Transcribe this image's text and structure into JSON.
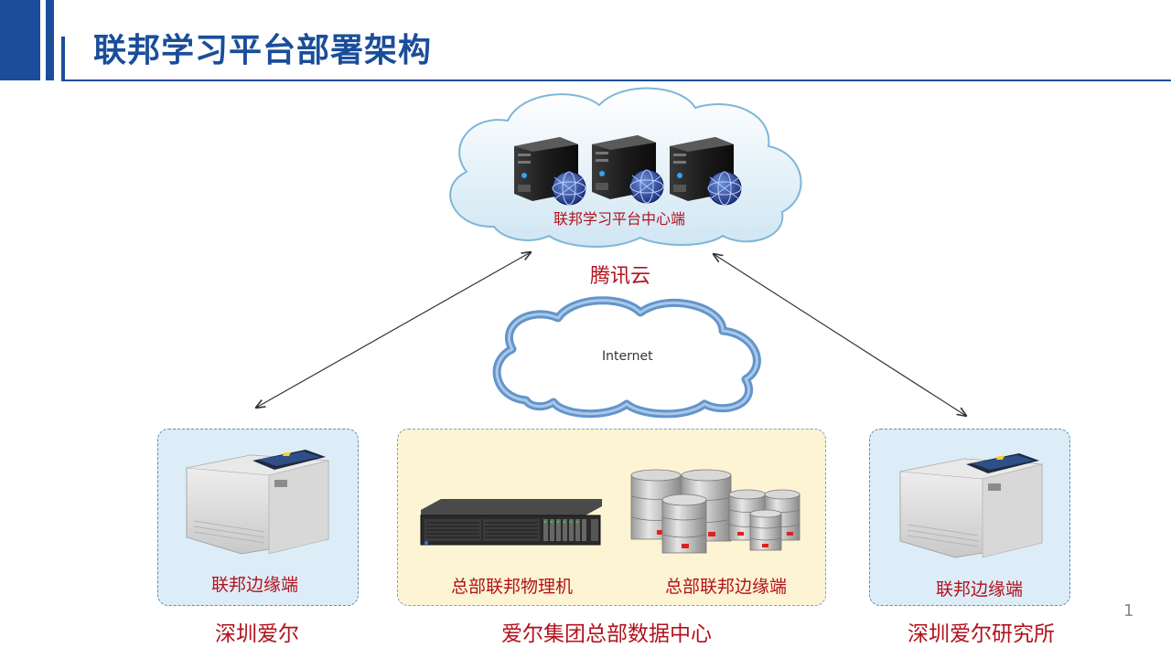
{
  "title": "联邦学习平台部署架构",
  "cloud": {
    "center_label": "联邦学习平台中心端",
    "provider_label": "腾讯云"
  },
  "internet": {
    "label": "Internet"
  },
  "sites": {
    "left": {
      "node_label": "联邦边缘端",
      "site_label": "深圳爱尔"
    },
    "middle": {
      "physical_label": "总部联邦物理机",
      "edge_label": "总部联邦边缘端",
      "site_label": "爱尔集团总部数据中心"
    },
    "right": {
      "node_label": "联邦边缘端",
      "site_label": "深圳爱尔研究所"
    }
  },
  "page_number": "1",
  "colors": {
    "accent": "#1a4e9a",
    "label_red": "#b3121d",
    "panel_blue": "#dcedf8",
    "panel_yellow": "#fdf4d3"
  }
}
